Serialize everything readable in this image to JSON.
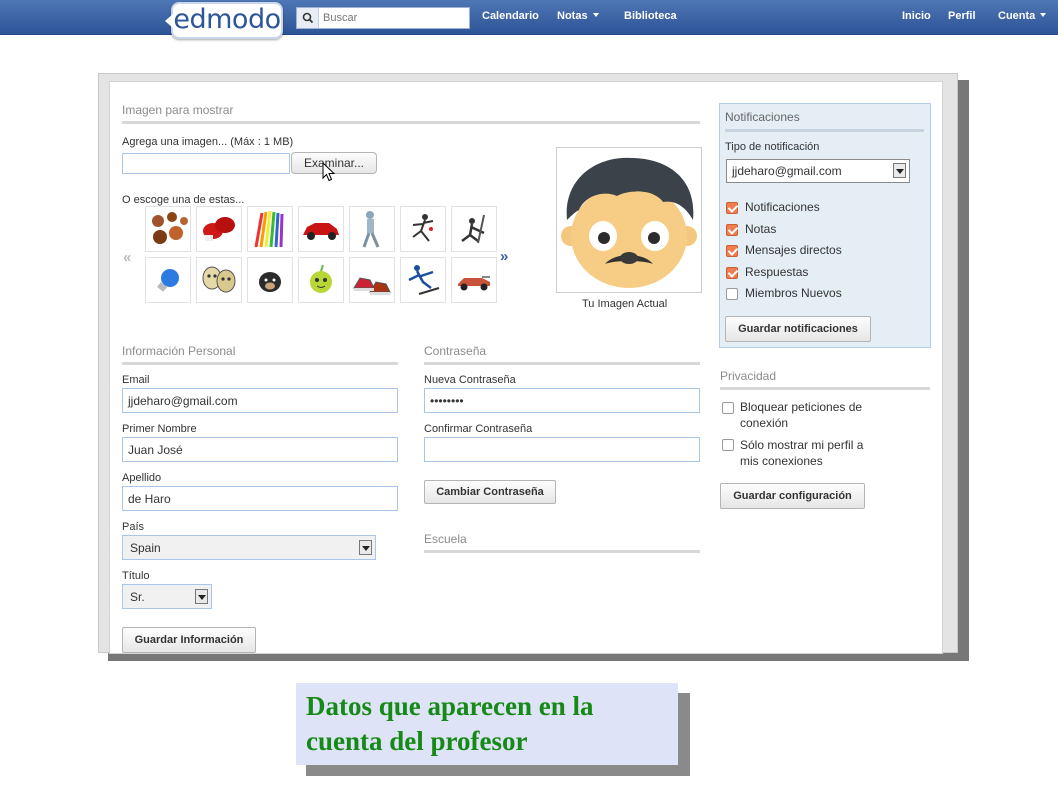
{
  "nav": {
    "logo": "edmodo",
    "search_placeholder": "Buscar",
    "links": [
      "Calendario",
      "Notas",
      "Biblioteca"
    ],
    "right_links": [
      "Inicio",
      "Perfil",
      "Cuenta"
    ]
  },
  "image_section": {
    "title": "Imagen para mostrar",
    "add_label": "Agrega una imagen... (Máx : 1 MB)",
    "browse_button": "Examinar...",
    "choose_label": "O escoge una de estas...",
    "prev_arrow": "«",
    "next_arrow": "»",
    "current_image_label": "Tu Imagen Actual",
    "thumbnails_row1": [
      "balls-icon",
      "boxing-gloves-icon",
      "pencils-icon",
      "red-car-icon",
      "robot-figure-icon",
      "dancer-icon",
      "hockey-player-icon"
    ],
    "thumbnails_row2": [
      "lightbulb-icon",
      "theater-masks-icon",
      "dog-icon",
      "apple-face-icon",
      "sneakers-icon",
      "skier-icon",
      "race-car-icon"
    ]
  },
  "personal": {
    "title": "Información Personal",
    "email_label": "Email",
    "email_value": "jjdeharo@gmail.com",
    "first_name_label": "Primer Nombre",
    "first_name_value": "Juan José",
    "last_name_label": "Apellido",
    "last_name_value": "de Haro",
    "country_label": "País",
    "country_value": "Spain",
    "title_label": "Título",
    "title_value": "Sr.",
    "save_button": "Guardar Información"
  },
  "password": {
    "title": "Contraseña",
    "new_label": "Nueva Contraseña",
    "new_value": "••••••••",
    "confirm_label": "Confirmar Contraseña",
    "confirm_value": "",
    "change_button": "Cambiar Contraseña"
  },
  "school": {
    "title": "Escuela"
  },
  "notifications": {
    "title": "Notificaciones",
    "type_label": "Tipo de notificación",
    "type_value": "jjdeharo@gmail.com",
    "options": [
      {
        "label": "Notificaciones",
        "checked": true
      },
      {
        "label": "Notas",
        "checked": true
      },
      {
        "label": "Mensajes directos",
        "checked": true
      },
      {
        "label": "Respuestas",
        "checked": true
      },
      {
        "label": "Miembros Nuevos",
        "checked": false
      }
    ],
    "save_button": "Guardar notificaciones"
  },
  "privacy": {
    "title": "Privacidad",
    "option1_line1": "Bloquear peticiones de",
    "option1_line2": "conexión",
    "option2_line1": "Sólo mostrar mi perfil a",
    "option2_line2": "mis conexiones",
    "save_button": "Guardar configuración"
  },
  "caption": {
    "line1": "Datos que aparecen en la",
    "line2": "cuenta del profesor"
  },
  "colors": {
    "nav_bar": "#3a63a6",
    "checkbox_checked": "#ef7d4f",
    "caption_text": "#168a16",
    "caption_bg": "#dfe3f7"
  }
}
